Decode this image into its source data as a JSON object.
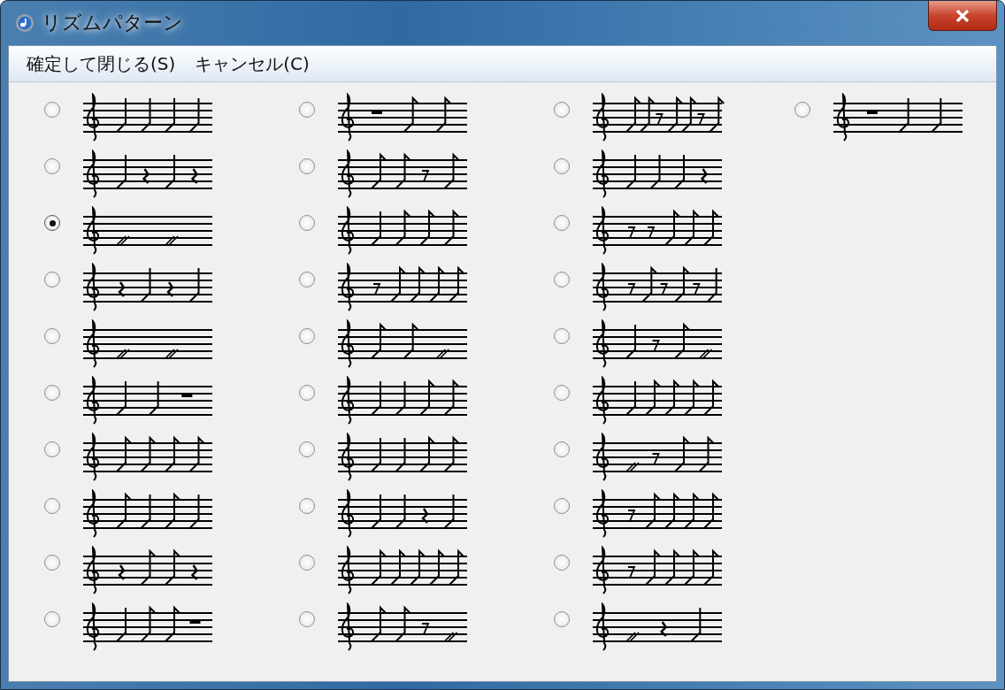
{
  "window": {
    "title": "リズムパターン"
  },
  "menu": [
    {
      "label": "確定して閉じる(S)"
    },
    {
      "label": "キャンセル(C)"
    }
  ],
  "columns": [
    {
      "options": [
        {
          "selected": false
        },
        {
          "selected": false
        },
        {
          "selected": true
        },
        {
          "selected": false
        },
        {
          "selected": false
        },
        {
          "selected": false
        },
        {
          "selected": false
        },
        {
          "selected": false
        },
        {
          "selected": false
        },
        {
          "selected": false
        }
      ]
    },
    {
      "options": [
        {
          "selected": false
        },
        {
          "selected": false
        },
        {
          "selected": false
        },
        {
          "selected": false
        },
        {
          "selected": false
        },
        {
          "selected": false
        },
        {
          "selected": false
        },
        {
          "selected": false
        },
        {
          "selected": false
        },
        {
          "selected": false
        }
      ]
    },
    {
      "options": [
        {
          "selected": false
        },
        {
          "selected": false
        },
        {
          "selected": false
        },
        {
          "selected": false
        },
        {
          "selected": false
        },
        {
          "selected": false
        },
        {
          "selected": false
        },
        {
          "selected": false
        },
        {
          "selected": false
        },
        {
          "selected": false
        }
      ]
    },
    {
      "options": [
        {
          "selected": false
        }
      ]
    }
  ]
}
